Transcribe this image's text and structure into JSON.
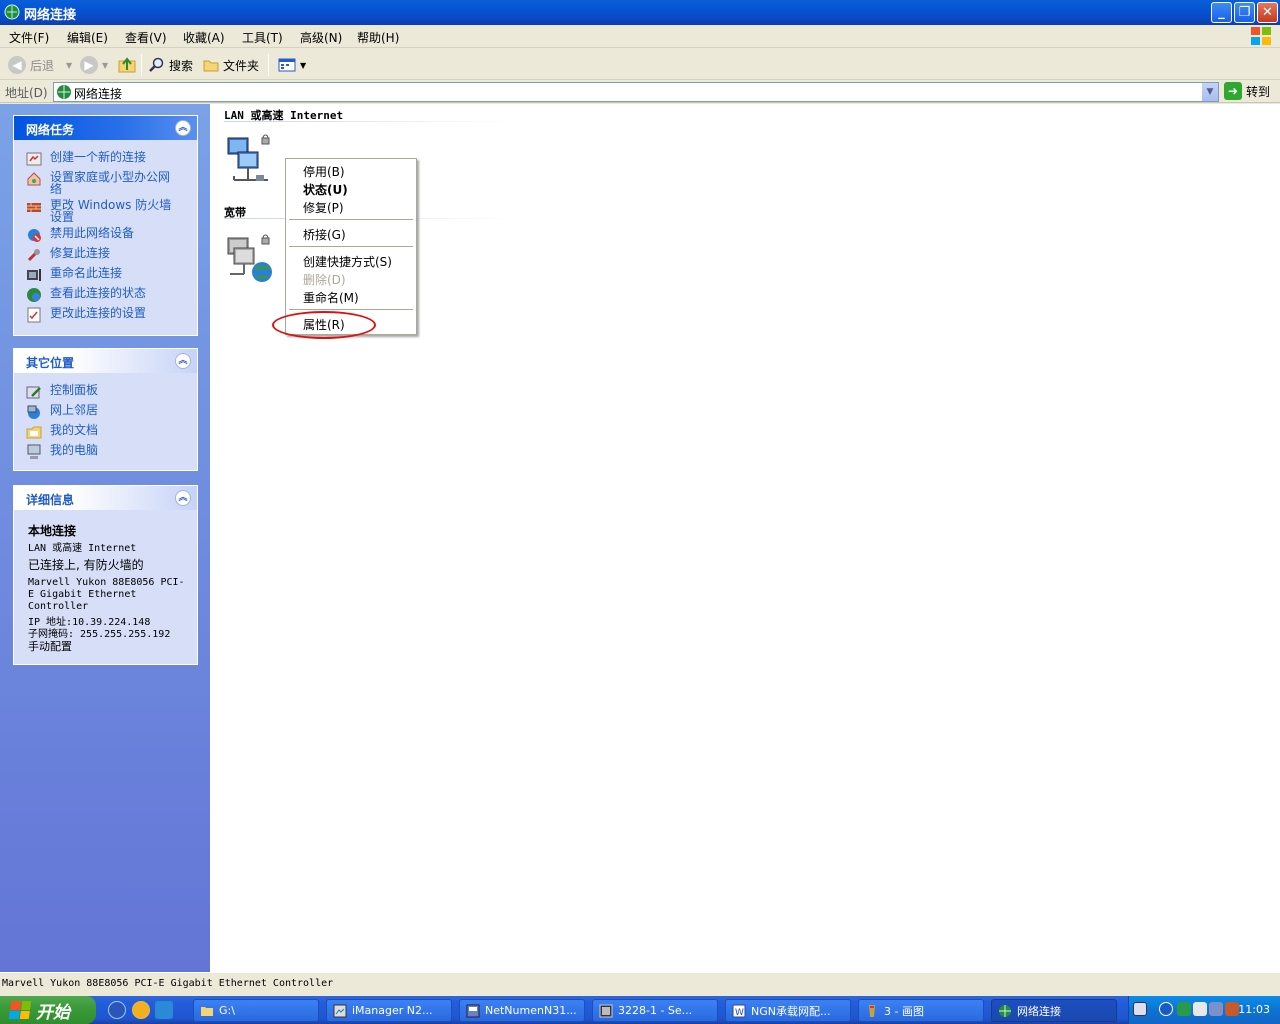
{
  "window": {
    "title": "网络连接",
    "controls": [
      "_",
      "❐",
      "✕"
    ]
  },
  "menu": [
    "文件(F)",
    "编辑(E)",
    "查看(V)",
    "收藏(A)",
    "工具(T)",
    "高级(N)",
    "帮助(H)"
  ],
  "toolbar": {
    "back": "后退",
    "search": "搜索",
    "folders": "文件夹"
  },
  "address": {
    "label": "地址(D)",
    "value": "网络连接",
    "go": "转到"
  },
  "sidebar": {
    "network_tasks": {
      "title": "网络任务",
      "items": [
        {
          "label": "创建一个新的连接",
          "icon": "new-connection-icon"
        },
        {
          "label": "设置家庭或小型办公网络",
          "icon": "home-network-icon"
        },
        {
          "label": "更改 Windows 防火墙设置",
          "icon": "firewall-icon"
        },
        {
          "label": "禁用此网络设备",
          "icon": "disable-device-icon"
        },
        {
          "label": "修复此连接",
          "icon": "repair-icon"
        },
        {
          "label": "重命名此连接",
          "icon": "rename-icon"
        },
        {
          "label": "查看此连接的状态",
          "icon": "status-icon"
        },
        {
          "label": "更改此连接的设置",
          "icon": "settings-icon"
        }
      ]
    },
    "other_places": {
      "title": "其它位置",
      "items": [
        {
          "label": "控制面板",
          "icon": "control-panel-icon"
        },
        {
          "label": "网上邻居",
          "icon": "network-places-icon"
        },
        {
          "label": "我的文档",
          "icon": "my-documents-icon"
        },
        {
          "label": "我的电脑",
          "icon": "my-computer-icon"
        }
      ]
    },
    "details": {
      "title": "详细信息",
      "name": "本地连接",
      "type": "LAN 或高速 Internet",
      "status": "已连接上, 有防火墙的",
      "device": "Marvell Yukon 88E8056 PCI-E Gigabit Ethernet Controller",
      "ip": "IP 地址:10.39.224.148",
      "mask": "子网掩码: 255.255.255.192",
      "config": "手动配置"
    }
  },
  "main": {
    "groups": [
      {
        "title": "LAN 或高速 Internet"
      },
      {
        "title": "宽带"
      }
    ]
  },
  "context_menu": {
    "items": [
      {
        "label": "停用(B)",
        "bold": false,
        "disabled": false
      },
      {
        "label": "状态(U)",
        "bold": true,
        "disabled": false
      },
      {
        "label": "修复(P)",
        "bold": false,
        "disabled": false
      },
      {
        "label": "桥接(G)",
        "bold": false,
        "disabled": false
      },
      {
        "label": "创建快捷方式(S)",
        "bold": false,
        "disabled": false
      },
      {
        "label": "删除(D)",
        "bold": false,
        "disabled": true
      },
      {
        "label": "重命名(M)",
        "bold": false,
        "disabled": false
      },
      {
        "label": "属性(R)",
        "bold": false,
        "disabled": false
      }
    ]
  },
  "statusbar": {
    "text": "Marvell Yukon 88E8056 PCI-E Gigabit Ethernet Controller"
  },
  "taskbar": {
    "start": "开始",
    "buttons": [
      {
        "label": "G:\\",
        "active": false
      },
      {
        "label": "iManager N2...",
        "active": false
      },
      {
        "label": "NetNumenN31...",
        "active": false
      },
      {
        "label": "3228-1 - Se...",
        "active": false
      },
      {
        "label": "NGN承载网配...",
        "active": false
      },
      {
        "label": "3 - 画图",
        "active": false
      },
      {
        "label": "网络连接",
        "active": true
      }
    ],
    "clock": "11:03"
  },
  "colors": {
    "titlebar": "#0a5fd8",
    "task_link": "#215dc6",
    "highlight_ellipse": "#e01010",
    "start_green": "#3c9a3a"
  }
}
